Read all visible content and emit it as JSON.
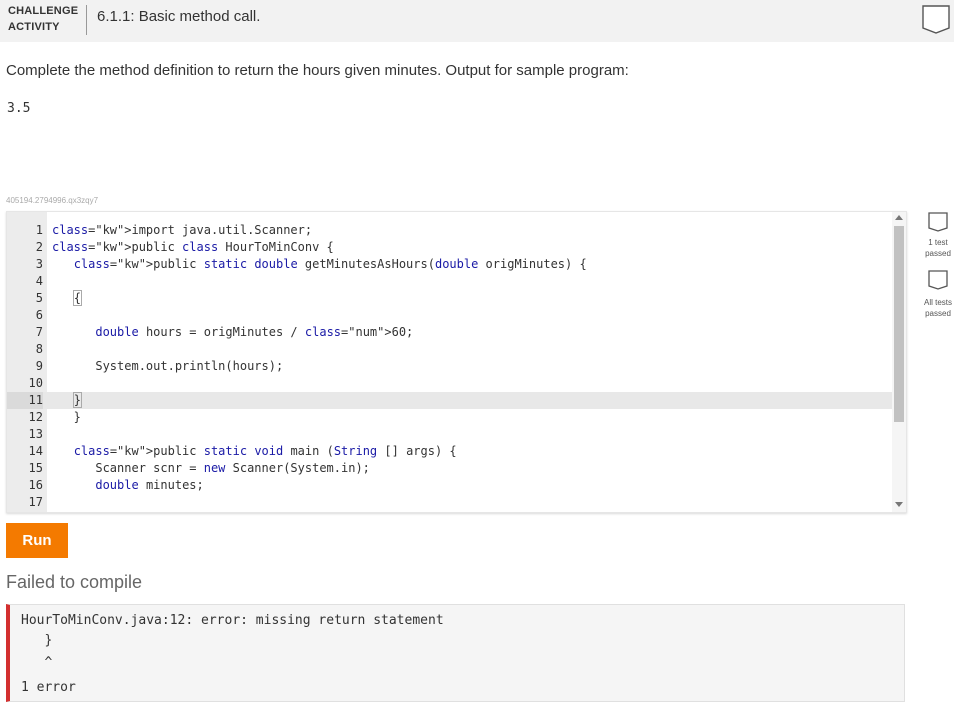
{
  "header": {
    "label_line1": "CHALLENGE",
    "label_line2": "ACTIVITY",
    "title": "6.1.1: Basic method call."
  },
  "instructions": "Complete the method definition to return the hours given minutes. Output for sample program:",
  "sample_output": "3.5",
  "activity_id": "405194.2794996.qx3zqy7",
  "editor": {
    "active_line": 11,
    "lines": [
      {
        "n": "1",
        "text": "import java.util.Scanner;"
      },
      {
        "n": "2",
        "text": "public class HourToMinConv {"
      },
      {
        "n": "3",
        "text": "   public static double getMinutesAsHours(double origMinutes) {"
      },
      {
        "n": "4",
        "text": ""
      },
      {
        "n": "5",
        "text": "   {"
      },
      {
        "n": "6",
        "text": ""
      },
      {
        "n": "7",
        "text": "      double hours = origMinutes / 60;"
      },
      {
        "n": "8",
        "text": ""
      },
      {
        "n": "9",
        "text": "      System.out.println(hours);"
      },
      {
        "n": "10",
        "text": ""
      },
      {
        "n": "11",
        "text": "   }"
      },
      {
        "n": "12",
        "text": "   }"
      },
      {
        "n": "13",
        "text": ""
      },
      {
        "n": "14",
        "text": "   public static void main (String [] args) {"
      },
      {
        "n": "15",
        "text": "      Scanner scnr = new Scanner(System.in);"
      },
      {
        "n": "16",
        "text": "      double minutes;"
      },
      {
        "n": "17",
        "text": ""
      }
    ]
  },
  "tests": {
    "test1_label_line1": "1 test",
    "test1_label_line2": "passed",
    "all_label_line1": "All tests",
    "all_label_line2": "passed"
  },
  "run_label": "Run",
  "status": "Failed to compile",
  "console": {
    "lines": [
      "HourToMinConv.java:12: error: missing return statement",
      "   }",
      "   ^",
      "1 error"
    ]
  },
  "colors": {
    "run_button": "#f47a00",
    "error_border": "#d32f2f",
    "keyword": "#1a1aa6",
    "number": "#098658"
  },
  "icons": {
    "header_badge": "badge-outline-icon",
    "test_badge": "badge-outline-icon"
  }
}
